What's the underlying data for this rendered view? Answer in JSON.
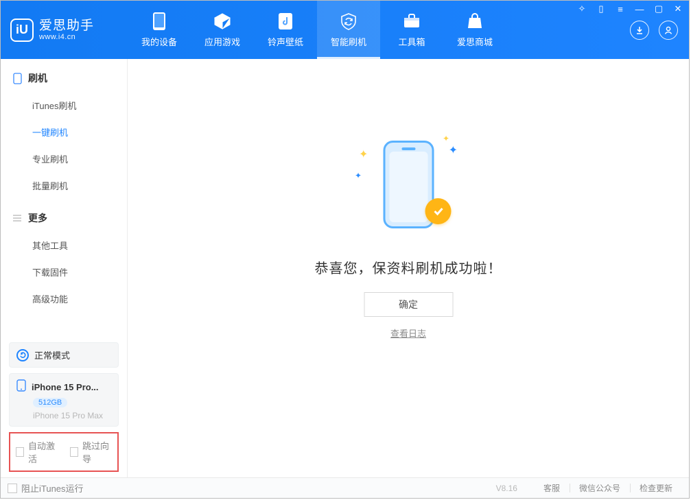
{
  "app": {
    "name": "爱思助手",
    "url": "www.i4.cn",
    "logo_letters": "iU"
  },
  "tabs": [
    {
      "label": "我的设备"
    },
    {
      "label": "应用游戏"
    },
    {
      "label": "铃声壁纸"
    },
    {
      "label": "智能刷机",
      "active": true
    },
    {
      "label": "工具箱"
    },
    {
      "label": "爱思商城"
    }
  ],
  "sidebar": {
    "group1": {
      "title": "刷机"
    },
    "items1": [
      {
        "label": "iTunes刷机"
      },
      {
        "label": "一键刷机",
        "active": true
      },
      {
        "label": "专业刷机"
      },
      {
        "label": "批量刷机"
      }
    ],
    "group2": {
      "title": "更多"
    },
    "items2": [
      {
        "label": "其他工具"
      },
      {
        "label": "下载固件"
      },
      {
        "label": "高级功能"
      }
    ]
  },
  "mode": {
    "label": "正常模式"
  },
  "device": {
    "name": "iPhone 15 Pro...",
    "capacity": "512GB",
    "model": "iPhone 15 Pro Max"
  },
  "checks": {
    "auto_activate": "自动激活",
    "skip_wizard": "跳过向导"
  },
  "success": {
    "title": "恭喜您，保资料刷机成功啦！",
    "ok": "确定",
    "view_log": "查看日志"
  },
  "footer": {
    "block_itunes": "阻止iTunes运行",
    "version": "V8.16",
    "links": [
      "客服",
      "微信公众号",
      "检查更新"
    ]
  }
}
